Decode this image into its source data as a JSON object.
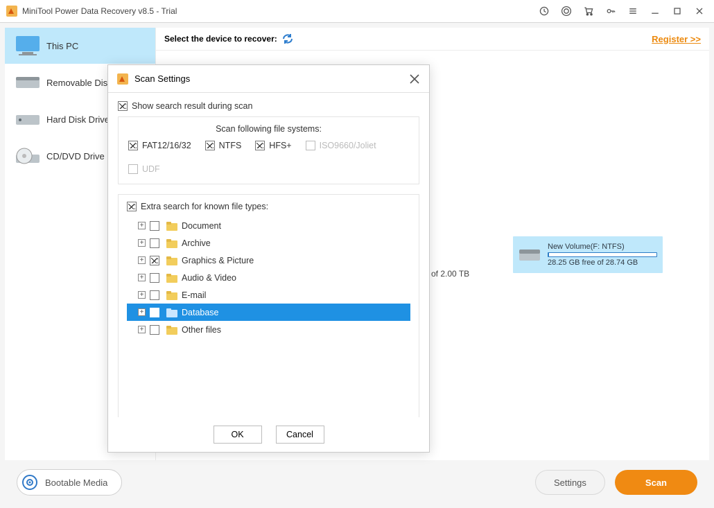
{
  "titlebar": {
    "title": "MiniTool Power Data Recovery v8.5 - Trial"
  },
  "sidebar": {
    "items": [
      {
        "label": "This PC"
      },
      {
        "label": "Removable Disk Drive"
      },
      {
        "label": "Hard Disk Drive"
      },
      {
        "label": "CD/DVD Drive"
      }
    ]
  },
  "main": {
    "heading": "Select the device to recover:",
    "register": "Register >>",
    "of_text": "of 2.00 TB"
  },
  "volume": {
    "name": "New Volume(F: NTFS)",
    "free": "28.25 GB free of 28.74 GB"
  },
  "footer": {
    "bootable": "Bootable Media",
    "settings": "Settings",
    "scan": "Scan"
  },
  "modal": {
    "title": "Scan Settings",
    "show_results": "Show search result during scan",
    "fs_title": "Scan following file systems:",
    "fs": [
      {
        "label": "FAT12/16/32",
        "checked": true,
        "enabled": true
      },
      {
        "label": "NTFS",
        "checked": true,
        "enabled": true
      },
      {
        "label": "HFS+",
        "checked": true,
        "enabled": true
      },
      {
        "label": "ISO9660/Joliet",
        "checked": false,
        "enabled": false
      },
      {
        "label": "UDF",
        "checked": false,
        "enabled": false
      }
    ],
    "extra_label": "Extra search for known file types:",
    "tree": [
      {
        "label": "Document",
        "checked": false,
        "selected": false
      },
      {
        "label": "Archive",
        "checked": false,
        "selected": false
      },
      {
        "label": "Graphics & Picture",
        "checked": true,
        "selected": false
      },
      {
        "label": "Audio & Video",
        "checked": false,
        "selected": false
      },
      {
        "label": "E-mail",
        "checked": false,
        "selected": false
      },
      {
        "label": "Database",
        "checked": false,
        "selected": true
      },
      {
        "label": "Other files",
        "checked": false,
        "selected": false
      }
    ],
    "ok": "OK",
    "cancel": "Cancel"
  }
}
